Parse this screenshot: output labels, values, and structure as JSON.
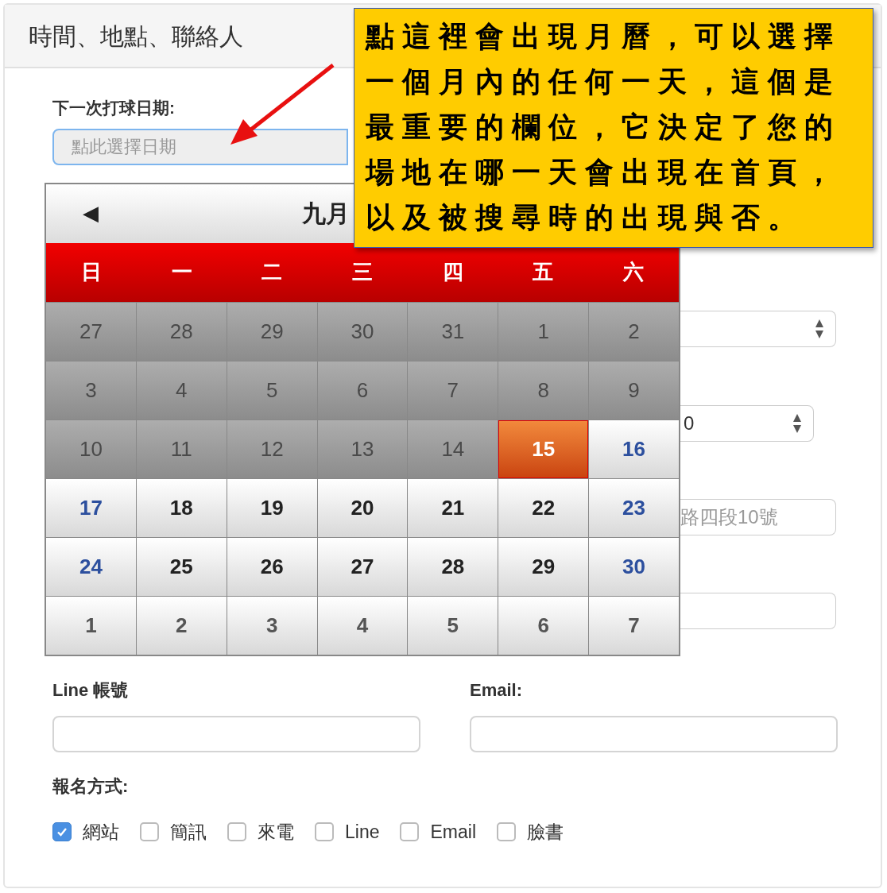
{
  "panel": {
    "title": "時間、地點、聯絡人"
  },
  "date_field": {
    "label": "下一次打球日期:",
    "placeholder": "點此選擇日期"
  },
  "calendar": {
    "prev": "◀",
    "month": "九月",
    "weekdays": [
      "日",
      "一",
      "二",
      "三",
      "四",
      "五",
      "六"
    ],
    "days": [
      {
        "day": "27",
        "kind": "past",
        "selected": false
      },
      {
        "day": "28",
        "kind": "past",
        "selected": false
      },
      {
        "day": "29",
        "kind": "past",
        "selected": false
      },
      {
        "day": "30",
        "kind": "past",
        "selected": false
      },
      {
        "day": "31",
        "kind": "past",
        "selected": false
      },
      {
        "day": "1",
        "kind": "past",
        "selected": false
      },
      {
        "day": "2",
        "kind": "past",
        "selected": false
      },
      {
        "day": "3",
        "kind": "past",
        "selected": false
      },
      {
        "day": "4",
        "kind": "past",
        "selected": false
      },
      {
        "day": "5",
        "kind": "past",
        "selected": false
      },
      {
        "day": "6",
        "kind": "past",
        "selected": false
      },
      {
        "day": "7",
        "kind": "past",
        "selected": false
      },
      {
        "day": "8",
        "kind": "past",
        "selected": false
      },
      {
        "day": "9",
        "kind": "past",
        "selected": false
      },
      {
        "day": "10",
        "kind": "past",
        "selected": false
      },
      {
        "day": "11",
        "kind": "past",
        "selected": false
      },
      {
        "day": "12",
        "kind": "past",
        "selected": false
      },
      {
        "day": "13",
        "kind": "past",
        "selected": false
      },
      {
        "day": "14",
        "kind": "past",
        "selected": false
      },
      {
        "day": "15",
        "kind": "current",
        "weekend": false,
        "selected": true
      },
      {
        "day": "16",
        "kind": "current",
        "weekend": true,
        "selected": false
      },
      {
        "day": "17",
        "kind": "current",
        "weekend": true,
        "selected": false
      },
      {
        "day": "18",
        "kind": "current",
        "weekend": false,
        "selected": false
      },
      {
        "day": "19",
        "kind": "current",
        "weekend": false,
        "selected": false
      },
      {
        "day": "20",
        "kind": "current",
        "weekend": false,
        "selected": false
      },
      {
        "day": "21",
        "kind": "current",
        "weekend": false,
        "selected": false
      },
      {
        "day": "22",
        "kind": "current",
        "weekend": false,
        "selected": false
      },
      {
        "day": "23",
        "kind": "current",
        "weekend": true,
        "selected": false
      },
      {
        "day": "24",
        "kind": "current",
        "weekend": true,
        "selected": false
      },
      {
        "day": "25",
        "kind": "current",
        "weekend": false,
        "selected": false
      },
      {
        "day": "26",
        "kind": "current",
        "weekend": false,
        "selected": false
      },
      {
        "day": "27",
        "kind": "current",
        "weekend": false,
        "selected": false
      },
      {
        "day": "28",
        "kind": "current",
        "weekend": false,
        "selected": false
      },
      {
        "day": "29",
        "kind": "current",
        "weekend": false,
        "selected": false
      },
      {
        "day": "30",
        "kind": "current",
        "weekend": true,
        "selected": false
      },
      {
        "day": "1",
        "kind": "next",
        "selected": false
      },
      {
        "day": "2",
        "kind": "next",
        "selected": false
      },
      {
        "day": "3",
        "kind": "next",
        "selected": false
      },
      {
        "day": "4",
        "kind": "next",
        "selected": false
      },
      {
        "day": "5",
        "kind": "next",
        "selected": false
      },
      {
        "day": "6",
        "kind": "next",
        "selected": false
      },
      {
        "day": "7",
        "kind": "next",
        "selected": false
      }
    ]
  },
  "side_fields": [
    {
      "kind": "select"
    },
    {
      "kind": "select",
      "value": "0"
    },
    {
      "kind": "input",
      "placeholder": "路四段10號"
    },
    {
      "kind": "input"
    }
  ],
  "contact": [
    {
      "label": "Line 帳號"
    },
    {
      "label": "Email:"
    }
  ],
  "signup": {
    "label": "報名方式:",
    "options": [
      {
        "label": "網站",
        "checked": true
      },
      {
        "label": "簡訊",
        "checked": false
      },
      {
        "label": "來電",
        "checked": false
      },
      {
        "label": "Line",
        "checked": false
      },
      {
        "label": "Email",
        "checked": false
      },
      {
        "label": "臉書",
        "checked": false
      }
    ]
  },
  "annotation": {
    "lines": [
      "點這裡會出現月曆，可以選擇",
      "一個月內的任何一天，這個是",
      "最重要的欄位，它決定了您的",
      "場地在哪一天會出現在首頁，",
      "以及被搜尋時的出現與否。"
    ]
  }
}
